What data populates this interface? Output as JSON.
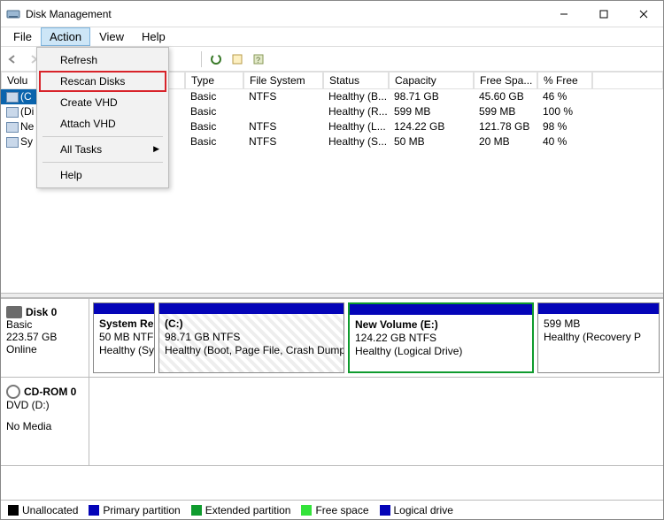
{
  "window": {
    "title": "Disk Management"
  },
  "menubar": {
    "file": "File",
    "action": "Action",
    "view": "View",
    "help": "Help"
  },
  "dropdown": {
    "refresh": "Refresh",
    "rescan": "Rescan Disks",
    "create_vhd": "Create VHD",
    "attach_vhd": "Attach VHD",
    "all_tasks": "All Tasks",
    "help": "Help"
  },
  "columns": {
    "volume": "Volu",
    "layout": "",
    "type": "Type",
    "fs": "File System",
    "status": "Status",
    "capacity": "Capacity",
    "free": "Free Spa...",
    "pct": "% Free"
  },
  "volumes": [
    {
      "vol": "(C",
      "type": "Basic",
      "fs": "NTFS",
      "status": "Healthy (B...",
      "cap": "98.71 GB",
      "free": "45.60 GB",
      "pct": "46 %",
      "sel": true
    },
    {
      "vol": "(Di",
      "type": "Basic",
      "fs": "",
      "status": "Healthy (R...",
      "cap": "599 MB",
      "free": "599 MB",
      "pct": "100 %",
      "sel": false
    },
    {
      "vol": "Ne",
      "type": "Basic",
      "fs": "NTFS",
      "status": "Healthy (L...",
      "cap": "124.22 GB",
      "free": "121.78 GB",
      "pct": "98 %",
      "sel": false
    },
    {
      "vol": "Sy",
      "type": "Basic",
      "fs": "NTFS",
      "status": "Healthy (S...",
      "cap": "50 MB",
      "free": "20 MB",
      "pct": "40 %",
      "sel": false
    }
  ],
  "disk0": {
    "name": "Disk 0",
    "kind": "Basic",
    "size": "223.57 GB",
    "state": "Online",
    "parts": [
      {
        "title": "System Re",
        "line2": "50 MB NTF",
        "line3": "Healthy (Sy"
      },
      {
        "title": "(C:)",
        "line2": "98.71 GB NTFS",
        "line3": "Healthy (Boot, Page File, Crash Dump"
      },
      {
        "title": "New Volume  (E:)",
        "line2": "124.22 GB NTFS",
        "line3": "Healthy (Logical Drive)"
      },
      {
        "title": "",
        "line2": "599 MB",
        "line3": "Healthy (Recovery P"
      }
    ]
  },
  "cdrom": {
    "name": "CD-ROM 0",
    "kind": "DVD (D:)",
    "state": "No Media"
  },
  "legend": {
    "unalloc": "Unallocated",
    "primary": "Primary partition",
    "extended": "Extended partition",
    "free": "Free space",
    "logical": "Logical drive"
  }
}
